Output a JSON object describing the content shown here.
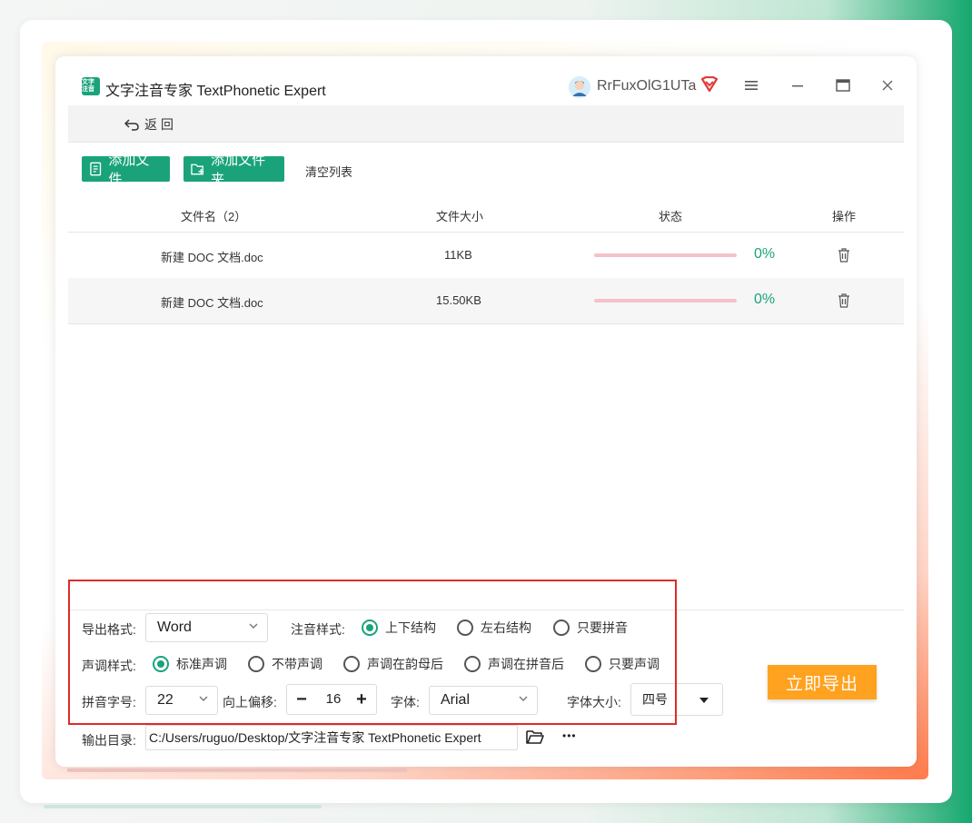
{
  "app": {
    "title": "文字注音专家 TextPhonetic Expert",
    "logo_text": "文字注音",
    "username": "RrFuxOlG1UTa"
  },
  "nav": {
    "back_label": "返回"
  },
  "toolbar": {
    "add_file_label": "添加文件",
    "add_folder_label": "添加文件夹",
    "clear_list_label": "清空列表"
  },
  "table": {
    "headers": {
      "name": "文件名（2）",
      "size": "文件大小",
      "status": "状态",
      "action": "操作"
    },
    "rows": [
      {
        "name": "新建 DOC 文档.doc",
        "size": "11KB",
        "progress": "0%",
        "progress_value": 0
      },
      {
        "name": "新建 DOC 文档.doc",
        "size": "15.50KB",
        "progress": "0%",
        "progress_value": 0
      }
    ]
  },
  "settings": {
    "export_format_label": "导出格式:",
    "export_format_value": "Word",
    "annotation_style_label": "注音样式:",
    "annotation_options": [
      "上下结构",
      "左右结构",
      "只要拼音"
    ],
    "annotation_selected": 0,
    "tone_style_label": "声调样式:",
    "tone_options": [
      "标准声调",
      "不带声调",
      "声调在韵母后",
      "声调在拼音后",
      "只要声调"
    ],
    "tone_selected": 0,
    "pinyin_size_label": "拼音字号:",
    "pinyin_size_value": "22",
    "offset_label": "向上偏移:",
    "offset_value": "16",
    "offset_minus": "−",
    "offset_plus": "+",
    "font_label": "字体:",
    "font_value": "Arial",
    "font_size_label": "字体大小:",
    "font_size_value": "四号",
    "output_dir_label": "输出目录:",
    "output_dir_value": "C:/Users/ruguo/Desktop/文字注音专家 TextPhonetic Expert",
    "more_label": "•••"
  },
  "export_button_label": "立即导出",
  "colors": {
    "accent": "#1aa37a",
    "export": "#ffa21f",
    "highlight_box": "#e02a2a",
    "progress_track": "#f4c1c8"
  }
}
